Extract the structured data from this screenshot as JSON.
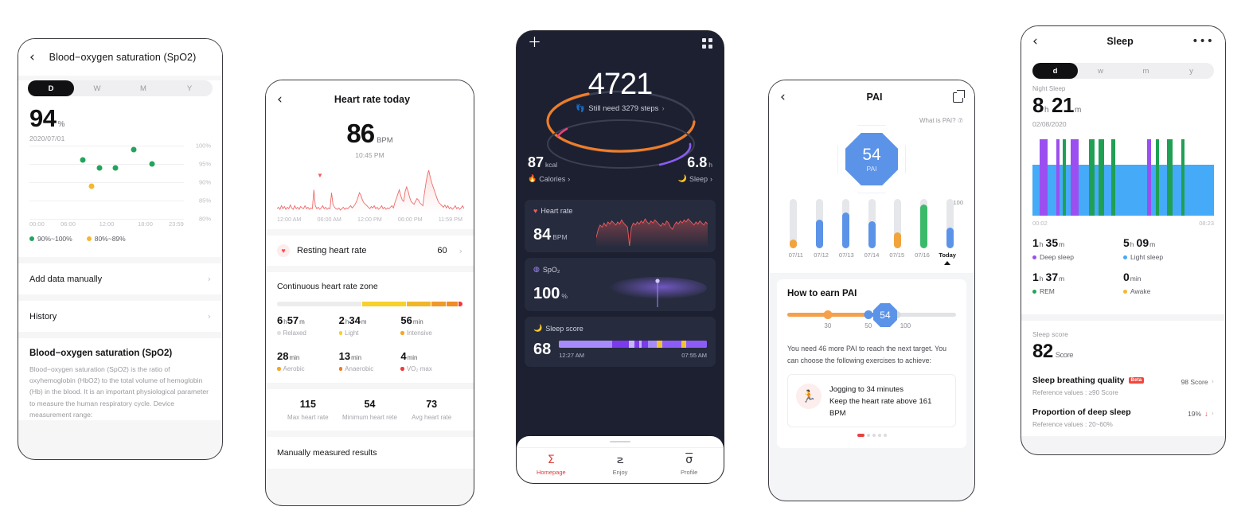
{
  "spo2_panel": {
    "back_icon": "chevron-left-icon",
    "title": "Blood−oxygen saturation (SpO2)",
    "tabs": [
      {
        "label": "D",
        "active": true
      },
      {
        "label": "W",
        "active": false
      },
      {
        "label": "M",
        "active": false
      },
      {
        "label": "Y",
        "active": false
      }
    ],
    "value": "94",
    "unit": "%",
    "date": "2020/07/01",
    "legend": [
      {
        "label": "90%~100%",
        "color": "#22a45d"
      },
      {
        "label": "80%~89%",
        "color": "#f4b731"
      }
    ],
    "rows": [
      {
        "label": "Add data manually",
        "arrow": "›"
      },
      {
        "label": "History",
        "arrow": "›"
      }
    ],
    "info_heading": "Blood−oxygen saturation (SpO2)",
    "info_text": "Blood−oxygen saturation (SpO2) is the ratio of oxyhemoglobin (HbO2) to the total volume of hemoglobin (Hb) in the blood. It is an important physiological parameter to measure the human respiratory cycle. Device measurement range:",
    "chart_data": {
      "type": "scatter",
      "title": "Blood-oxygen saturation over the day",
      "xlabel": "",
      "ylabel": "",
      "grid": true,
      "ylim": [
        80,
        100
      ],
      "yticks": [
        100,
        95,
        90,
        85,
        80
      ],
      "ytick_labels": [
        "100%",
        "95%",
        "90%",
        "85%",
        "80%"
      ],
      "xticks": [
        "00:00",
        "06:00",
        "12:00",
        "18:00",
        "23:59"
      ],
      "points": [
        {
          "x": "08:15",
          "y": 96,
          "color": "#22a45d"
        },
        {
          "x": "09:40",
          "y": 89,
          "color": "#f4b731"
        },
        {
          "x": "10:50",
          "y": 94,
          "color": "#22a45d"
        },
        {
          "x": "13:20",
          "y": 94,
          "color": "#22a45d"
        },
        {
          "x": "16:10",
          "y": 99,
          "color": "#22a45d"
        },
        {
          "x": "19:00",
          "y": 95,
          "color": "#22a45d"
        }
      ]
    }
  },
  "heart_panel": {
    "back_icon": "chevron-left-icon",
    "title": "Heart rate today",
    "value": "86",
    "unit": "BPM",
    "time": "10:45 PM",
    "resting": {
      "icon": "heart-icon",
      "label": "Resting heart rate",
      "value": "60",
      "arrow": "›"
    },
    "zone_heading": "Continuous heart rate zone",
    "zones": [
      {
        "value": "6",
        "u1": "h",
        "value2": "57",
        "u2": "m",
        "label": "Relaxed",
        "color": "#e9e9ec"
      },
      {
        "value": "2",
        "u1": "h",
        "value2": "34",
        "u2": "m",
        "label": "Light",
        "color": "#f7d02c"
      },
      {
        "value": "56",
        "u1": "min",
        "value2": "",
        "u2": "",
        "label": "Intensive",
        "color": "#f6a623"
      }
    ],
    "zones2": [
      {
        "value": "28",
        "unit": "min",
        "label": "Aerobic",
        "color": "#f5a623"
      },
      {
        "value": "13",
        "unit": "min",
        "label": "Anaerobic",
        "color": "#f07c1e"
      },
      {
        "value": "4",
        "unit": "min",
        "label": "VO₂ max",
        "color": "#ee3b3b"
      }
    ],
    "minmax": [
      {
        "value": "115",
        "label": "Max heart rate"
      },
      {
        "value": "54",
        "label": "Minimum heart rete"
      },
      {
        "value": "73",
        "label": "Avg heart rate"
      }
    ],
    "manual_label": "Manually measured results",
    "chart_data": {
      "type": "line",
      "title": "Heart rate today",
      "xlabel": "",
      "ylabel": "BPM",
      "xticks": [
        "12:00 AM",
        "06:00 AM",
        "12:00 PM",
        "06:00 PM",
        "11:59 PM"
      ],
      "line_color": "#ef6b6b",
      "series": [
        {
          "name": "Heart rate",
          "values": [
            62,
            64,
            61,
            66,
            62,
            65,
            61,
            64,
            62,
            67,
            63,
            61,
            66,
            62,
            64,
            61,
            65,
            63,
            62,
            66,
            62,
            64,
            61,
            63,
            62,
            88,
            66,
            62,
            64,
            61,
            63,
            66,
            62,
            64,
            61,
            63,
            62,
            84,
            68,
            64,
            62,
            61,
            63,
            60,
            62,
            64,
            61,
            63,
            62,
            64,
            66,
            63,
            65,
            68,
            72,
            78,
            84,
            80,
            74,
            70,
            68,
            66,
            64,
            62,
            65,
            63,
            66,
            62,
            64,
            61,
            63,
            66,
            62,
            64,
            61,
            63,
            62,
            64,
            66,
            63,
            70,
            76,
            82,
            88,
            80,
            74,
            72,
            86,
            92,
            86,
            78,
            72,
            70,
            68,
            72,
            76,
            74,
            70,
            68,
            66,
            82,
            96,
            108,
            115,
            106,
            98,
            92,
            86,
            80,
            74,
            70,
            68,
            66,
            64,
            67,
            63,
            66,
            62,
            64,
            61,
            63,
            66,
            62,
            64,
            61,
            63,
            66,
            62
          ]
        }
      ]
    }
  },
  "home_panel": {
    "add_icon": "plus-icon",
    "grid_icon": "grid-icon",
    "steps": "4721",
    "steps_sub": "Still need 3279 steps",
    "steps_arrow": "›",
    "footprint_icon": "footprints-icon",
    "calories": {
      "value": "87",
      "unit": "kcal",
      "label": "Calories",
      "icon": "flame-icon",
      "arrow": "›"
    },
    "sleep": {
      "value": "6.8",
      "unit": "h",
      "label": "Sleep",
      "icon": "moon-icon",
      "arrow": "›"
    },
    "cards": [
      {
        "icon": "heart-icon",
        "title": "Heart rate",
        "value": "84",
        "unit": "BPM"
      },
      {
        "icon": "droplet-icon",
        "title": "SpO₂",
        "value": "100",
        "unit": "%"
      },
      {
        "icon": "moon-icon",
        "title": "Sleep score",
        "value": "68",
        "start": "12:27 AM",
        "end": "07:55 AM"
      }
    ],
    "nav": [
      {
        "glyph": "Σ",
        "label": "Homepage",
        "icon": "sigma-icon",
        "active": true
      },
      {
        "glyph": "౽",
        "label": "Enjoy",
        "icon": "infinity-icon",
        "active": false
      },
      {
        "glyph": "σ",
        "label": "Profile",
        "icon": "sigma-profile-icon",
        "active": false
      }
    ],
    "chart_data": {
      "type": "line",
      "title": "Heart rate (dark card)",
      "line_color": "#f05a5a",
      "series": [
        {
          "name": "Heart rate",
          "values": [
            70,
            78,
            82,
            80,
            84,
            81,
            85,
            83,
            86,
            84,
            82,
            85,
            83,
            87,
            84,
            82,
            80,
            62,
            80,
            84,
            82,
            85,
            83,
            86,
            84,
            88,
            85,
            83,
            86,
            84,
            87,
            85,
            83,
            81,
            84,
            82,
            86,
            84,
            80,
            78,
            82,
            85,
            83,
            86,
            84,
            87,
            85,
            88,
            86,
            84,
            82,
            85,
            83,
            86,
            84,
            82,
            85,
            83
          ]
        }
      ]
    },
    "sleep_score_chart": {
      "type": "bar",
      "title": "Sleep score timeline",
      "base_color": "#8b5cf6",
      "segments": [
        {
          "start": 0,
          "width": 36,
          "color": "#a78bfa"
        },
        {
          "start": 36,
          "width": 11,
          "color": "#7c3aed"
        },
        {
          "start": 47,
          "width": 4,
          "color": "#c4b5fd"
        },
        {
          "start": 51,
          "width": 3,
          "color": "#7c3aed"
        },
        {
          "start": 54,
          "width": 2,
          "color": "#c4b5fd"
        },
        {
          "start": 56,
          "width": 4,
          "color": "#7c3aed"
        },
        {
          "start": 60,
          "width": 6,
          "color": "#a78bfa"
        },
        {
          "start": 66,
          "width": 4,
          "color": "#f4c430"
        },
        {
          "start": 70,
          "width": 13,
          "color": "#8b5cf6"
        },
        {
          "start": 83,
          "width": 3,
          "color": "#f4c430"
        },
        {
          "start": 86,
          "width": 14,
          "color": "#8b5cf6"
        }
      ]
    }
  },
  "pai_panel": {
    "back_icon": "chevron-left-icon",
    "title": "PAI",
    "share_icon": "share-icon",
    "what_is": "What is PAI?",
    "help_icon": "question-circle-icon",
    "score": "54",
    "score_label": "PAI",
    "axis_max": "100",
    "how_heading": "How to earn PAI",
    "slider_ticks": [
      "30",
      "50",
      "100"
    ],
    "slider_value": "54",
    "description": "You need 46 more PAI to reach the next target. You can choose the following exercises to achieve:",
    "exercise": {
      "icon": "running-icon",
      "line1": "Jogging to 34 minutes",
      "line2": "Keep the heart rate above 161 BPM"
    },
    "chart_data": {
      "type": "bar",
      "title": "PAI weekly",
      "categories": [
        "07/11",
        "07/12",
        "07/13",
        "07/14",
        "07/15",
        "07/16",
        "Today"
      ],
      "ylim": [
        0,
        100
      ],
      "values": [
        18,
        58,
        72,
        55,
        33,
        88,
        42
      ],
      "colors": [
        "#f2a33c",
        "#5b93e8",
        "#5b93e8",
        "#5b93e8",
        "#f2a33c",
        "#3cba6b",
        "#5b93e8"
      ],
      "track_color": "#e6e7eb"
    }
  },
  "sleep_panel": {
    "back_icon": "chevron-left-icon",
    "title": "Sleep",
    "more_icon": "more-horizontal-icon",
    "tabs": [
      {
        "label": "d",
        "active": true
      },
      {
        "label": "w",
        "active": false
      },
      {
        "label": "m",
        "active": false
      },
      {
        "label": "y",
        "active": false
      }
    ],
    "night_label": "Night Sleep",
    "duration_h": "8",
    "uh": "h",
    "duration_m": "21",
    "um": "m",
    "date": "02/08/2020",
    "stats": [
      {
        "value": "1",
        "u1": "h",
        "value2": "35",
        "u2": "m",
        "label": "Deep sleep",
        "color": "#9b4ff0"
      },
      {
        "value": "5",
        "u1": "h",
        "value2": "09",
        "u2": "m",
        "label": "Light sleep",
        "color": "#45aaf7"
      },
      {
        "value": "1",
        "u1": "h",
        "value2": "37",
        "u2": "m",
        "label": "REM",
        "color": "#22a45d"
      },
      {
        "value": "0",
        "u1": "min",
        "value2": "",
        "u2": "",
        "label": "Awake",
        "color": "#f4b731"
      }
    ],
    "score_label": "Sleep score",
    "score_value": "82",
    "score_unit": "Score",
    "quality": {
      "title": "Sleep breathing quality",
      "badge": "Beta",
      "reference": "Reference values : ≥90 Score",
      "value": "98 Score",
      "arrow": "›"
    },
    "deep": {
      "title": "Proportion of deep sleep",
      "reference": "Reference values : 20~60%",
      "value": "19%",
      "trend": "down",
      "arrow": "›"
    },
    "chart_data": {
      "type": "bar",
      "title": "Sleep hypnogram",
      "xlabel": "",
      "ylabel": "",
      "xticks": [
        "00:02",
        "08:23"
      ],
      "light_band_color": "#45aaf7",
      "stages": [
        {
          "start": 4,
          "width": 4.5,
          "stage": "deep",
          "color": "#9b4ff0"
        },
        {
          "start": 13,
          "width": 2,
          "stage": "deep",
          "color": "#9b4ff0"
        },
        {
          "start": 16.5,
          "width": 2,
          "stage": "rem",
          "color": "#1fa055"
        },
        {
          "start": 21,
          "width": 4.5,
          "stage": "deep",
          "color": "#9b4ff0"
        },
        {
          "start": 31,
          "width": 3,
          "stage": "rem",
          "color": "#1fa055"
        },
        {
          "start": 36.5,
          "width": 3,
          "stage": "rem",
          "color": "#1fa055"
        },
        {
          "start": 43.5,
          "width": 2,
          "stage": "rem",
          "color": "#1fa055"
        },
        {
          "start": 63,
          "width": 2.5,
          "stage": "deep",
          "color": "#9b4ff0"
        },
        {
          "start": 68,
          "width": 1.8,
          "stage": "rem",
          "color": "#1fa055"
        },
        {
          "start": 74,
          "width": 3,
          "stage": "rem",
          "color": "#1fa055"
        },
        {
          "start": 82,
          "width": 1.8,
          "stage": "rem",
          "color": "#1fa055"
        }
      ]
    }
  }
}
